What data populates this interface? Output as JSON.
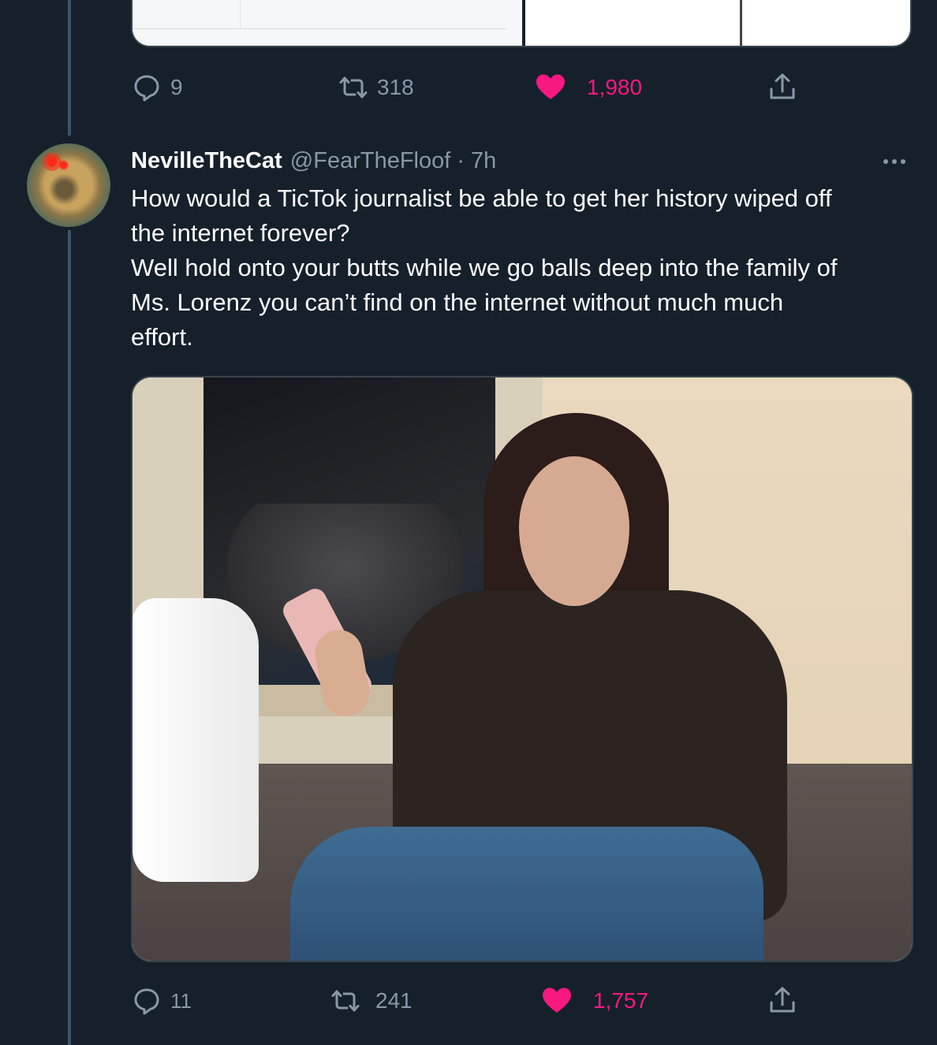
{
  "previous_tweet": {
    "actions": {
      "reply_count": "9",
      "retweet_count": "318",
      "like_count": "1,980"
    }
  },
  "tweet": {
    "author_name": "NevilleTheCat",
    "author_handle": "@FearTheFloof",
    "separator": "·",
    "time": "7h",
    "text_lines": [
      "How would a TicTok journalist be able to get her history wiped off",
      "the internet forever?",
      "Well hold onto your butts while we go balls deep into the family of",
      "Ms. Lorenz you can’t find on the internet without much much",
      "effort."
    ],
    "actions": {
      "reply_count": "11",
      "retweet_count": "241",
      "like_count": "1,757"
    }
  },
  "colors": {
    "background": "#15202b",
    "muted_text": "#8899a6",
    "like_pink": "#f91880",
    "border": "#38444d"
  },
  "icons": {
    "reply": "reply-icon",
    "retweet": "retweet-icon",
    "like": "heart-icon",
    "share": "share-icon",
    "more": "more-icon"
  }
}
